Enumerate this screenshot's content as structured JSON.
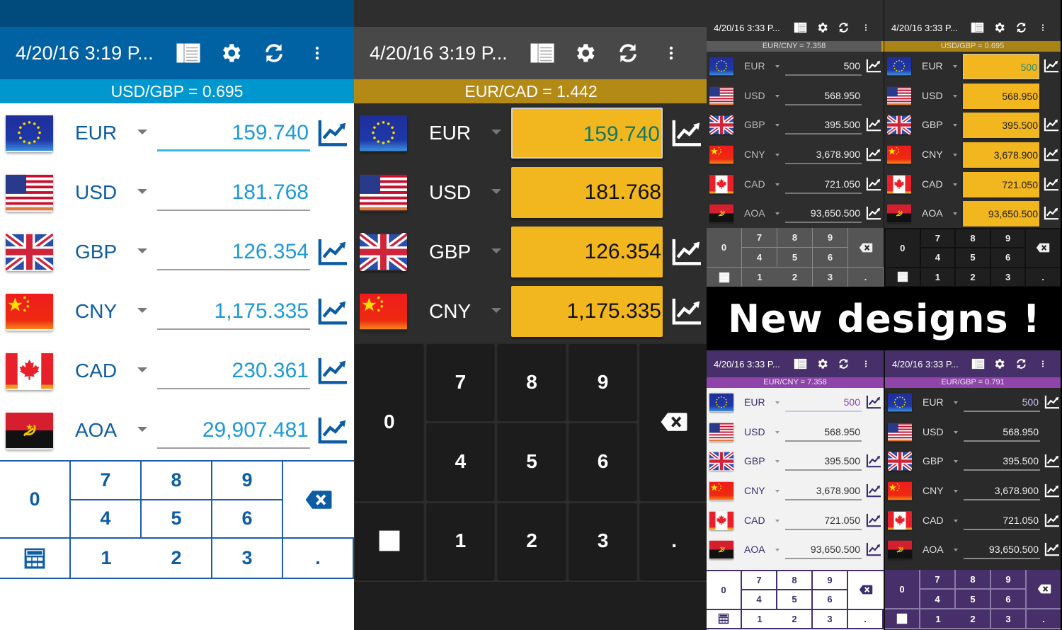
{
  "screens": [
    {
      "theme": "blue",
      "toolbar": {
        "title": "4/20/16 3:19 P...",
        "icons": [
          "list-view-icon",
          "settings-gear-icon",
          "refresh-icon",
          "more-vert-icon"
        ]
      },
      "rate_bar": "USD/GBP = 0.695",
      "rows": [
        {
          "flag": "eu",
          "code": "EUR",
          "value": "159.740",
          "chart": true,
          "active": true
        },
        {
          "flag": "us",
          "code": "USD",
          "value": "181.768",
          "chart": false
        },
        {
          "flag": "gb",
          "code": "GBP",
          "value": "126.354",
          "chart": true
        },
        {
          "flag": "cn",
          "code": "CNY",
          "value": "1,175.335",
          "chart": true
        },
        {
          "flag": "ca",
          "code": "CAD",
          "value": "230.361",
          "chart": true
        },
        {
          "flag": "ao",
          "code": "AOA",
          "value": "29,907.481",
          "chart": true
        }
      ]
    },
    {
      "theme": "dark-yellow",
      "toolbar": {
        "title": "4/20/16 3:19 P...",
        "icons": [
          "list-view-icon",
          "settings-gear-icon",
          "refresh-icon",
          "more-vert-icon"
        ]
      },
      "rate_bar": "EUR/CAD = 1.442",
      "rows": [
        {
          "flag": "eu",
          "code": "EUR",
          "value": "159.740",
          "chart": true,
          "active": true
        },
        {
          "flag": "us",
          "code": "USD",
          "value": "181.768",
          "chart": false
        },
        {
          "flag": "gb",
          "code": "GBP",
          "value": "126.354",
          "chart": true
        },
        {
          "flag": "cn",
          "code": "CNY",
          "value": "1,175.335",
          "chart": true
        }
      ]
    },
    {
      "theme": "dark-grey",
      "toolbar": {
        "title": "4/20/16 3:33 P...",
        "icons": [
          "list-view-icon",
          "settings-gear-icon",
          "refresh-icon",
          "more-vert-icon"
        ]
      },
      "rate_bar": "EUR/CNY = 7.358",
      "rows": [
        {
          "flag": "eu",
          "code": "EUR",
          "value": "500",
          "chart": true,
          "active": true
        },
        {
          "flag": "us",
          "code": "USD",
          "value": "568.950",
          "chart": false
        },
        {
          "flag": "gb",
          "code": "GBP",
          "value": "395.500",
          "chart": true
        },
        {
          "flag": "cn",
          "code": "CNY",
          "value": "3,678.900",
          "chart": true
        },
        {
          "flag": "ca",
          "code": "CAD",
          "value": "721.050",
          "chart": true
        },
        {
          "flag": "ao",
          "code": "AOA",
          "value": "93,650.500",
          "chart": true
        }
      ]
    },
    {
      "theme": "dark-yellow-small",
      "toolbar": {
        "title": "4/20/16 3:33 P...",
        "icons": [
          "list-view-icon",
          "settings-gear-icon",
          "refresh-icon",
          "more-vert-icon"
        ]
      },
      "rate_bar": "USD/GBP = 0.695",
      "rows": [
        {
          "flag": "eu",
          "code": "EUR",
          "value": "500",
          "chart": true,
          "active": true
        },
        {
          "flag": "us",
          "code": "USD",
          "value": "568.950",
          "chart": false
        },
        {
          "flag": "gb",
          "code": "GBP",
          "value": "395.500",
          "chart": true
        },
        {
          "flag": "cn",
          "code": "CNY",
          "value": "3,678.900",
          "chart": true
        },
        {
          "flag": "ca",
          "code": "CAD",
          "value": "721.050",
          "chart": true
        },
        {
          "flag": "ao",
          "code": "AOA",
          "value": "93,650.500",
          "chart": true
        }
      ]
    },
    {
      "theme": "purple-light",
      "toolbar": {
        "title": "4/20/16 3:33 P...",
        "icons": [
          "list-view-icon",
          "settings-gear-icon",
          "refresh-icon",
          "more-vert-icon"
        ]
      },
      "rate_bar": "EUR/CNY = 7.358",
      "rows": [
        {
          "flag": "eu",
          "code": "EUR",
          "value": "500",
          "chart": true,
          "active": true
        },
        {
          "flag": "us",
          "code": "USD",
          "value": "568.950",
          "chart": false
        },
        {
          "flag": "gb",
          "code": "GBP",
          "value": "395.500",
          "chart": true
        },
        {
          "flag": "cn",
          "code": "CNY",
          "value": "3,678.900",
          "chart": true
        },
        {
          "flag": "ca",
          "code": "CAD",
          "value": "721.050",
          "chart": true
        },
        {
          "flag": "ao",
          "code": "AOA",
          "value": "93,650.500",
          "chart": true
        }
      ]
    },
    {
      "theme": "purple-dark",
      "toolbar": {
        "title": "4/20/16 3:33 P...",
        "icons": [
          "list-view-icon",
          "settings-gear-icon",
          "refresh-icon",
          "more-vert-icon"
        ]
      },
      "rate_bar": "EUR/GBP = 0.791",
      "rows": [
        {
          "flag": "eu",
          "code": "EUR",
          "value": "500",
          "chart": true,
          "active": true
        },
        {
          "flag": "us",
          "code": "USD",
          "value": "568.950",
          "chart": false
        },
        {
          "flag": "gb",
          "code": "GBP",
          "value": "395.500",
          "chart": true
        },
        {
          "flag": "cn",
          "code": "CNY",
          "value": "3,678.900",
          "chart": true
        },
        {
          "flag": "ca",
          "code": "CAD",
          "value": "721.050",
          "chart": true
        },
        {
          "flag": "ao",
          "code": "AOA",
          "value": "93,650.500",
          "chart": true
        }
      ]
    }
  ],
  "keypad": {
    "keys": [
      "0",
      "7",
      "8",
      "9",
      "backspace",
      "4",
      "5",
      "6",
      "calculator",
      "1",
      "2",
      "3",
      "."
    ],
    "labels": {
      "k0": "0",
      "k1": "1",
      "k2": "2",
      "k3": "3",
      "k4": "4",
      "k5": "5",
      "k6": "6",
      "k7": "7",
      "k8": "8",
      "k9": "9",
      "dot": "."
    }
  },
  "banner": {
    "text": "New designs !"
  },
  "colors": {
    "blue_primary": "#0061a3",
    "blue_rate_bar": "#0097cf",
    "yellow_field": "#f2b61f",
    "gold_rate_bar": "#b48a17",
    "purple_toolbar": "#47306a",
    "purple_rate_bar": "#8e44a9"
  }
}
